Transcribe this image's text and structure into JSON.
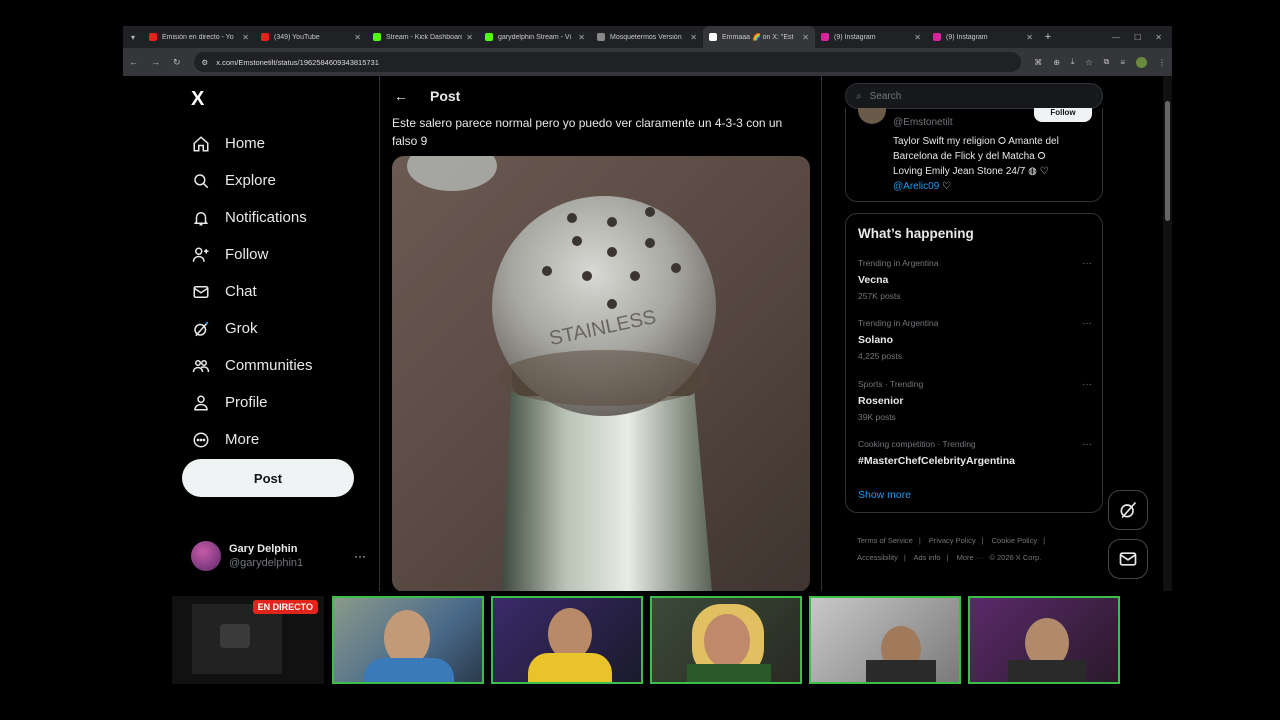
{
  "browser": {
    "tabs": [
      {
        "title": "Emisión en directo - Yo",
        "favicon_color": "#e1251b"
      },
      {
        "title": "(349) YouTube",
        "favicon_color": "#e1251b"
      },
      {
        "title": "Stream - Kick Dashboard",
        "favicon_color": "#53fc18"
      },
      {
        "title": "garydelphin Stream - Vi",
        "favicon_color": "#53fc18"
      },
      {
        "title": "Mosquetermos Versión",
        "favicon_color": "#888888"
      },
      {
        "title": "Emmaaa 🌈 on X: \"Est",
        "favicon_color": "#ffffff",
        "active": true
      },
      {
        "title": "(9) Instagram",
        "favicon_color": "#d6249f"
      },
      {
        "title": "(9) Instagram",
        "favicon_color": "#d6249f"
      }
    ],
    "url": "x.com/Emstonetilt/status/1962584609343815731"
  },
  "sidebar": {
    "logo": "X",
    "items": [
      {
        "label": "Home",
        "icon": "home-icon"
      },
      {
        "label": "Explore",
        "icon": "search-icon"
      },
      {
        "label": "Notifications",
        "icon": "bell-icon"
      },
      {
        "label": "Follow",
        "icon": "add-person-icon"
      },
      {
        "label": "Chat",
        "icon": "mail-icon"
      },
      {
        "label": "Grok",
        "icon": "grok-icon"
      },
      {
        "label": "Communities",
        "icon": "people-icon"
      },
      {
        "label": "Profile",
        "icon": "person-icon"
      },
      {
        "label": "More",
        "icon": "more-circle-icon"
      }
    ],
    "post_label": "Post",
    "user": {
      "name": "Gary Delphin",
      "handle": "@garydelphin1",
      "menu": "···"
    }
  },
  "post": {
    "header_title": "Post",
    "text": "Este salero parece normal pero yo puedo ver claramente un 4-3-3 con un falso 9",
    "media_engraving": "STAINLESS"
  },
  "right": {
    "search_placeholder": "Search",
    "profile": {
      "handle": "@Emstonetilt",
      "follow_label": "Follow",
      "bio_line1": "Taylor Swift my religion ⭘ Amante del",
      "bio_line2": "Barcelona de Flick y del Matcha ⭘",
      "bio_line3": "Loving Emily Jean Stone 24/7 ◍ ♡",
      "bio_mention": "@Arelic09",
      "bio_after_mention": " ♡"
    },
    "trends_title": "What’s happening",
    "trends": [
      {
        "meta": "Trending in Argentina",
        "name": "Vecna",
        "count": "257K posts"
      },
      {
        "meta": "Trending in Argentina",
        "name": "Solano",
        "count": "4,225 posts"
      },
      {
        "meta": "Sports · Trending",
        "name": "Rosenior",
        "count": "39K posts"
      },
      {
        "meta": "Cooking competition · Trending",
        "name": "#MasterChefCelebrityArgentina",
        "count": ""
      }
    ],
    "show_more": "Show more",
    "footer": {
      "terms": "Terms of Service",
      "privacy": "Privacy Policy",
      "cookie": "Cookie Policy",
      "accessibility": "Accessibility",
      "ads": "Ads info",
      "more": "More ···",
      "copyright": "© 2026 X Corp."
    }
  },
  "stream": {
    "live_badge": "EN DIRECTO"
  }
}
